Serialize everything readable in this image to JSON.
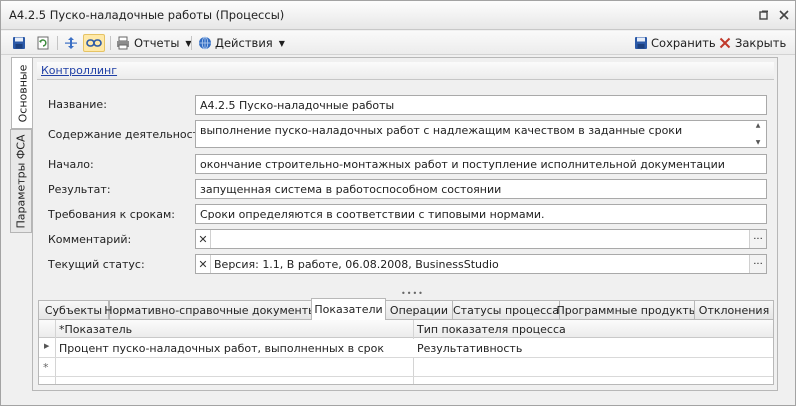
{
  "window": {
    "title": "А4.2.5 Пуско-наладочные работы (Процессы)"
  },
  "toolbar": {
    "reports_label": "Отчеты",
    "actions_label": "Действия",
    "save_label": "Сохранить",
    "close_label": "Закрыть"
  },
  "side_tabs": {
    "main": "Основные",
    "fsa": "Параметры ФСА"
  },
  "group": {
    "link": "Контроллинг"
  },
  "form": {
    "name_label": "Название:",
    "name_value": "А4.2.5 Пуско-наладочные работы",
    "content_label": "Содержание деятельности:",
    "content_value": "выполнение пуско-наладочных работ с надлежащим качеством в заданные сроки",
    "start_label": "Начало:",
    "start_value": "окончание строительно-монтажных работ и поступление исполнительной документации",
    "result_label": "Результат:",
    "result_value": "запущенная система в работоспособном состоянии",
    "deadline_label": "Требования к срокам:",
    "deadline_value": "Сроки определяются в соответствии с типовыми нормами.",
    "comment_label": "Комментарий:",
    "comment_value": "",
    "status_label": "Текущий статус:",
    "status_value": "Версия: 1.1, В работе, 06.08.2008, BusinessStudio"
  },
  "tabs": [
    "Субъекты",
    "Нормативно-справочные документы",
    "Показатели",
    "Операции",
    "Статусы процесса",
    "Программные продукты",
    "Отклонения"
  ],
  "grid": {
    "columns": [
      "*Показатель",
      "Тип показателя процесса"
    ],
    "rows": [
      [
        "Процент пуско-наладочных работ, выполненных в срок",
        "Результативность"
      ]
    ],
    "new_row_marker": "*"
  },
  "colors": {
    "link": "#1f3fa6",
    "active_button": "#ffe9a8",
    "close_red": "#c0392b"
  }
}
